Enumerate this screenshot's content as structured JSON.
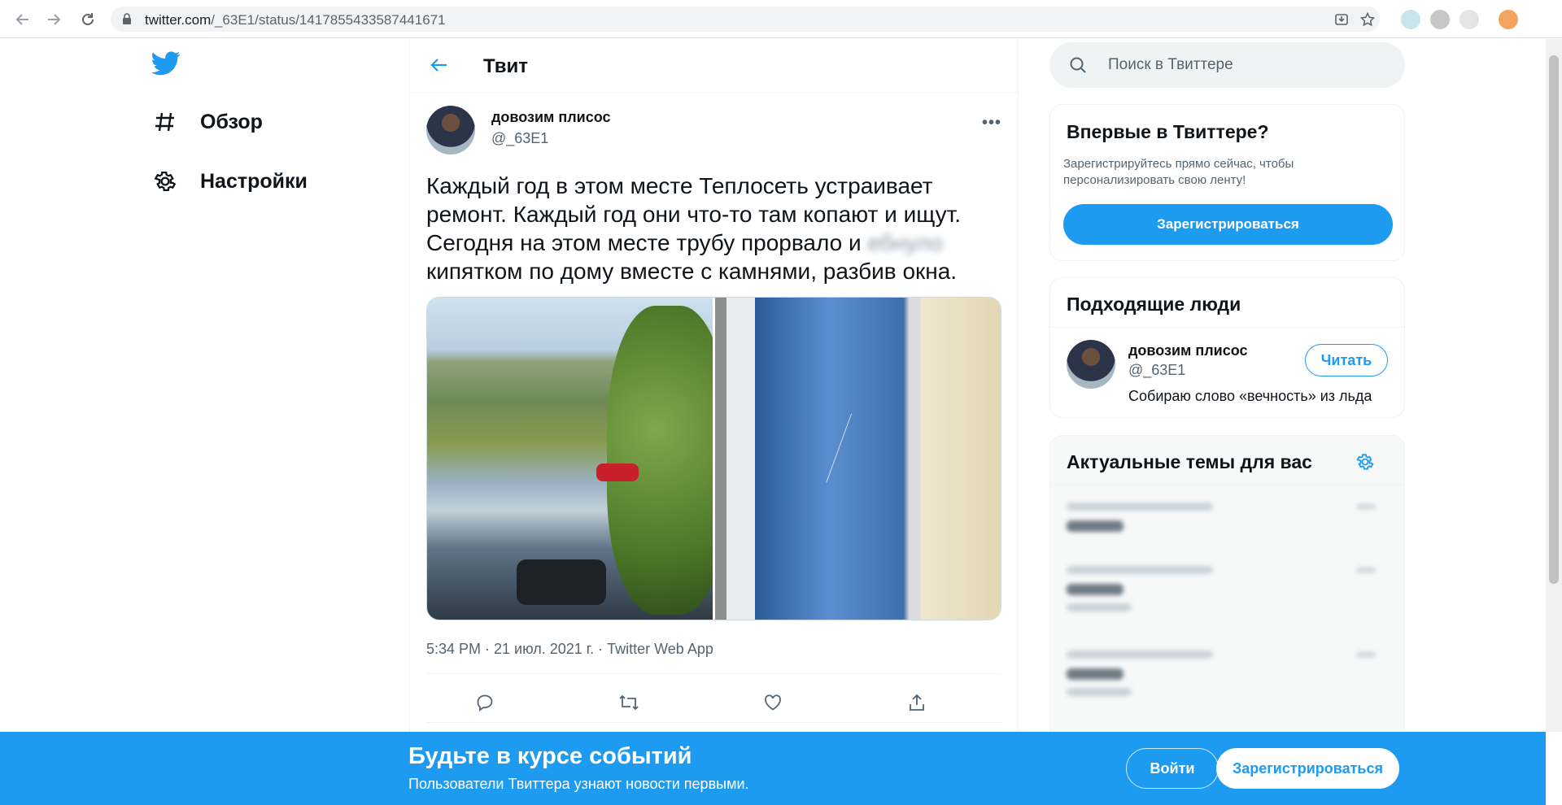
{
  "browser": {
    "url_host": "twitter.com",
    "url_path": "/_63E1/status/1417855433587441671"
  },
  "nav": {
    "items": [
      {
        "label": "Обзор",
        "icon": "hashtag-icon"
      },
      {
        "label": "Настройки",
        "icon": "gear-icon"
      }
    ]
  },
  "header": {
    "title": "Твит"
  },
  "tweet": {
    "author_name": "довозим плисос",
    "author_handle": "@_63E1",
    "text_before": "Каждый год в этом месте Теплосеть устраивает ремонт. Каждый год они что-то там копают и ищут. Сегодня на этом месте трубу прорвало и",
    "text_blurred": "ебнуло",
    "text_after": "кипятком по дому вместе с камнями, разбив окна.",
    "meta": "5:34 PM · 21 июл. 2021 г. · Twitter Web App"
  },
  "sidebar": {
    "search_placeholder": "Поиск в Твиттере",
    "signup": {
      "title": "Впервые в Твиттере?",
      "desc": "Зарегистрируйтесь прямо сейчас, чтобы персонализировать свою ленту!",
      "button": "Зарегистрироваться"
    },
    "people": {
      "title": "Подходящие люди",
      "name": "довозим плисос",
      "handle": "@_63E1",
      "bio": "Собираю слово «вечность» из льда",
      "follow": "Читать"
    },
    "trends": {
      "title": "Актуальные темы для вас"
    }
  },
  "banner": {
    "title": "Будьте в курсе событий",
    "subtitle": "Пользователи Твиттера узнают новости первыми.",
    "login": "Войти",
    "signup": "Зарегистрироваться"
  },
  "colors": {
    "accent": "#1d9bf0",
    "text": "#0f1419",
    "muted": "#536471"
  }
}
